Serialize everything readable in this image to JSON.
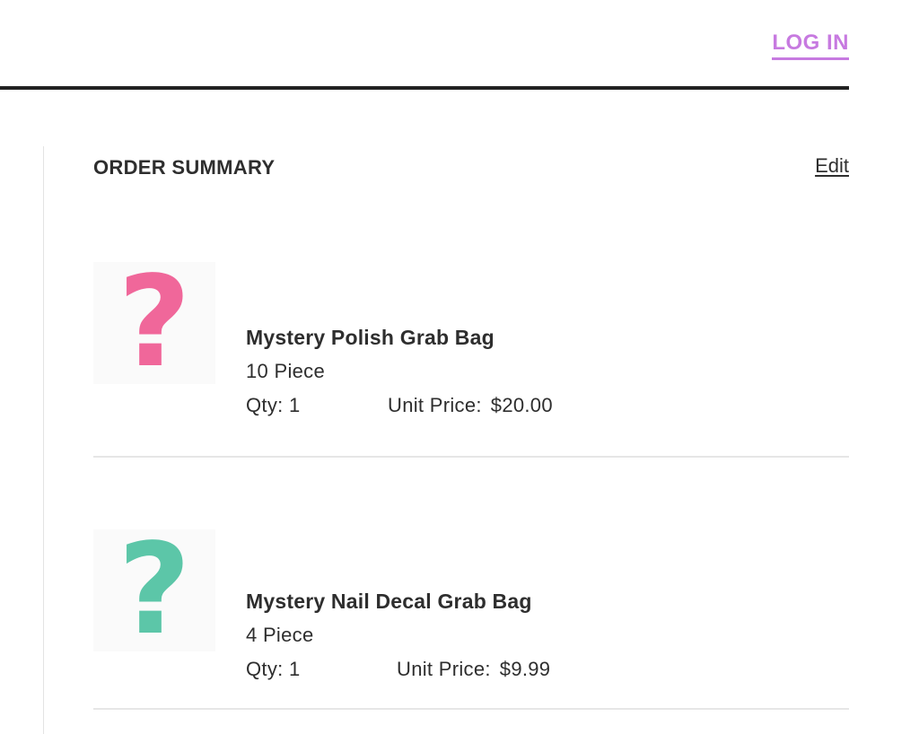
{
  "header": {
    "login_label": "LOG IN"
  },
  "order_summary": {
    "title": "ORDER SUMMARY",
    "edit_label": "Edit",
    "items": [
      {
        "name": "Mystery Polish Grab Bag",
        "variant": "10 Piece",
        "qty_text": "Qty: 1",
        "unit_price_label": "Unit Price:",
        "unit_price": "$20.00",
        "thumbnail_icon": "question-mark-icon",
        "thumbnail_color": "#f0679a"
      },
      {
        "name": "Mystery Nail Decal Grab Bag",
        "variant": "4 Piece",
        "qty_text": "Qty: 1",
        "unit_price_label": "Unit Price:",
        "unit_price": "$9.99",
        "thumbnail_icon": "question-mark-icon",
        "thumbnail_color": "#5cc6a8"
      }
    ]
  },
  "colors": {
    "accent": "#c77ae0",
    "divider": "#222222",
    "text": "#2e2e2e"
  }
}
